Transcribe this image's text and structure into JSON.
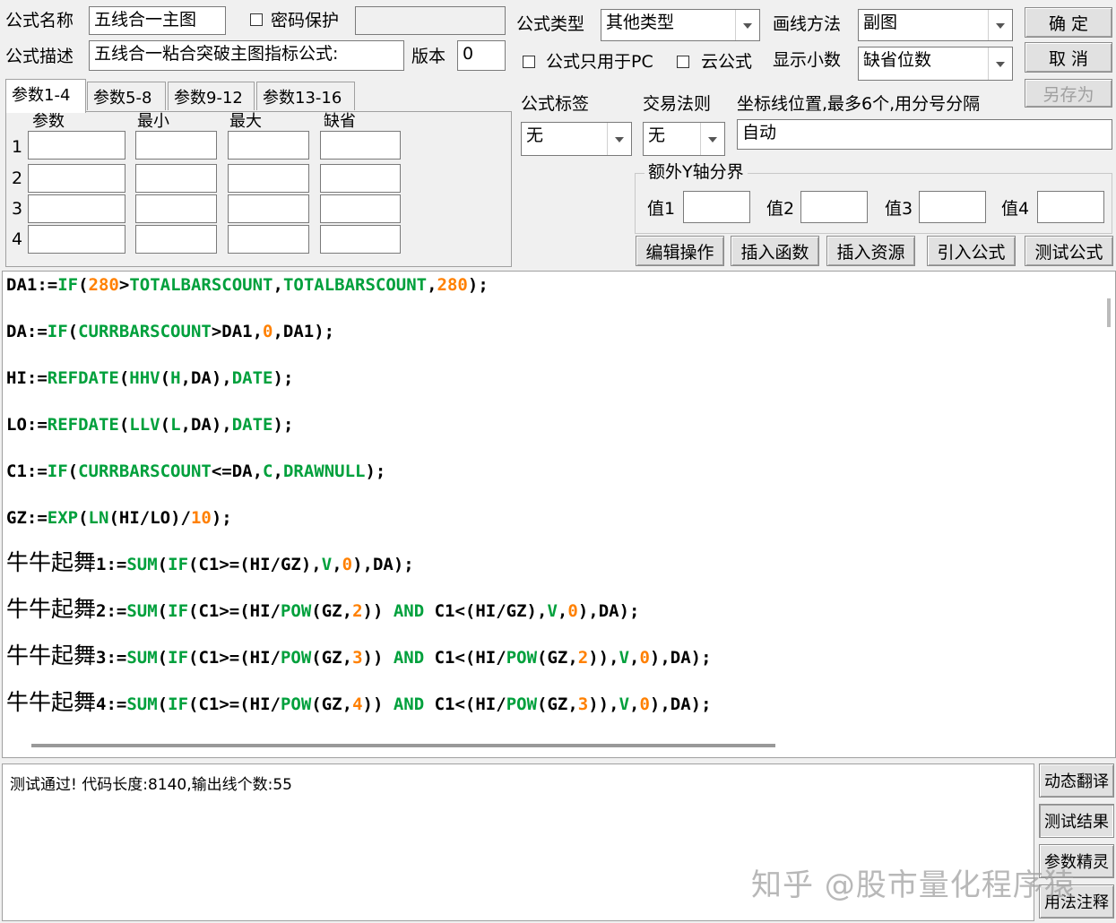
{
  "header": {
    "formula_name_label": "公式名称",
    "formula_name_value": "五线合一主图",
    "password_label": "密码保护",
    "formula_type_label": "公式类型",
    "formula_type_value": "其他类型",
    "draw_method_label": "画线方法",
    "draw_method_value": "副图",
    "formula_desc_label": "公式描述",
    "formula_desc_value": "五线合一粘合突破主图指标公式:",
    "version_label": "版本",
    "version_value": "0",
    "pc_only_label": "公式只用于PC",
    "cloud_label": "云公式",
    "decimals_label": "显示小数",
    "decimals_value": "缺省位数"
  },
  "buttons": {
    "ok": "确 定",
    "cancel": "取 消",
    "save_as": "另存为",
    "edit_ops": "编辑操作",
    "insert_func": "插入函数",
    "insert_res": "插入资源",
    "import_formula": "引入公式",
    "test_formula": "测试公式",
    "dyn_translate": "动态翻译",
    "test_result": "测试结果",
    "param_wizard": "参数精灵",
    "usage_notes": "用法注释"
  },
  "params": {
    "tabs": [
      "参数1-4",
      "参数5-8",
      "参数9-12",
      "参数13-16"
    ],
    "columns": [
      "参数",
      "最小",
      "最大",
      "缺省"
    ],
    "rows": [
      "1",
      "2",
      "3",
      "4"
    ]
  },
  "right_panel": {
    "tag_label": "公式标签",
    "tag_value": "无",
    "trade_rule_label": "交易法则",
    "trade_rule_value": "无",
    "axis_label": "坐标线位置,最多6个,用分号分隔",
    "axis_value": "自动",
    "extra_y_label": "额外Y轴分界",
    "value_labels": [
      "值1",
      "值2",
      "值3",
      "值4"
    ]
  },
  "output": {
    "message": "测试通过! 代码长度:8140,输出线个数:55"
  },
  "watermark": "知乎 @股市量化程序猿",
  "code_lines": [
    [
      [
        "DA1:=",
        ""
      ],
      [
        "IF",
        "kw"
      ],
      [
        "(",
        ""
      ],
      [
        "280",
        "num"
      ],
      [
        ">",
        ""
      ],
      [
        "TOTALBARSCOUNT",
        "kw"
      ],
      [
        ",",
        ""
      ],
      [
        "TOTALBARSCOUNT",
        "kw"
      ],
      [
        ",",
        ""
      ],
      [
        "280",
        "num"
      ],
      [
        ");",
        ""
      ]
    ],
    [
      [
        "DA:=",
        ""
      ],
      [
        "IF",
        "kw"
      ],
      [
        "(",
        ""
      ],
      [
        "CURRBARSCOUNT",
        "kw"
      ],
      [
        ">DA1,",
        ""
      ],
      [
        "0",
        "num"
      ],
      [
        ",DA1);",
        ""
      ]
    ],
    [
      [
        "HI:=",
        ""
      ],
      [
        "REFDATE",
        "kw"
      ],
      [
        "(",
        ""
      ],
      [
        "HHV",
        "kw"
      ],
      [
        "(",
        ""
      ],
      [
        "H",
        "kw"
      ],
      [
        ",DA),",
        ""
      ],
      [
        "DATE",
        "kw"
      ],
      [
        ");",
        ""
      ]
    ],
    [
      [
        "LO:=",
        ""
      ],
      [
        "REFDATE",
        "kw"
      ],
      [
        "(",
        ""
      ],
      [
        "LLV",
        "kw"
      ],
      [
        "(",
        ""
      ],
      [
        "L",
        "kw"
      ],
      [
        ",DA),",
        ""
      ],
      [
        "DATE",
        "kw"
      ],
      [
        ");",
        ""
      ]
    ],
    [
      [
        "C1:=",
        ""
      ],
      [
        "IF",
        "kw"
      ],
      [
        "(",
        ""
      ],
      [
        "CURRBARSCOUNT",
        "kw"
      ],
      [
        "<=DA,",
        ""
      ],
      [
        "C",
        "kw"
      ],
      [
        ",",
        ""
      ],
      [
        "DRAWNULL",
        "kw"
      ],
      [
        ");",
        ""
      ]
    ],
    [
      [
        "GZ:=",
        ""
      ],
      [
        "EXP",
        "kw"
      ],
      [
        "(",
        ""
      ],
      [
        "LN",
        "kw"
      ],
      [
        "(HI/LO)/",
        ""
      ],
      [
        "10",
        "num"
      ],
      [
        ");",
        ""
      ]
    ],
    [
      [
        "牛牛起舞",
        "hz"
      ],
      [
        "1:=",
        ""
      ],
      [
        "SUM",
        "kw"
      ],
      [
        "(",
        ""
      ],
      [
        "IF",
        "kw"
      ],
      [
        "(C1>=(HI/GZ),",
        ""
      ],
      [
        "V",
        "kw"
      ],
      [
        ",",
        ""
      ],
      [
        "0",
        "num"
      ],
      [
        "),DA);",
        ""
      ]
    ],
    [
      [
        "牛牛起舞",
        "hz"
      ],
      [
        "2:=",
        ""
      ],
      [
        "SUM",
        "kw"
      ],
      [
        "(",
        ""
      ],
      [
        "IF",
        "kw"
      ],
      [
        "(C1>=(HI/",
        ""
      ],
      [
        "POW",
        "kw"
      ],
      [
        "(GZ,",
        ""
      ],
      [
        "2",
        "num"
      ],
      [
        ")) ",
        ""
      ],
      [
        "AND",
        "kw"
      ],
      [
        " C1<(HI/GZ),",
        ""
      ],
      [
        "V",
        "kw"
      ],
      [
        ",",
        ""
      ],
      [
        "0",
        "num"
      ],
      [
        "),DA);",
        ""
      ]
    ],
    [
      [
        "牛牛起舞",
        "hz"
      ],
      [
        "3:=",
        ""
      ],
      [
        "SUM",
        "kw"
      ],
      [
        "(",
        ""
      ],
      [
        "IF",
        "kw"
      ],
      [
        "(C1>=(HI/",
        ""
      ],
      [
        "POW",
        "kw"
      ],
      [
        "(GZ,",
        ""
      ],
      [
        "3",
        "num"
      ],
      [
        ")) ",
        ""
      ],
      [
        "AND",
        "kw"
      ],
      [
        " C1<(HI/",
        ""
      ],
      [
        "POW",
        "kw"
      ],
      [
        "(GZ,",
        ""
      ],
      [
        "2",
        "num"
      ],
      [
        ")),",
        ""
      ],
      [
        "V",
        "kw"
      ],
      [
        ",",
        ""
      ],
      [
        "0",
        "num"
      ],
      [
        "),DA);",
        ""
      ]
    ],
    [
      [
        "牛牛起舞",
        "hz"
      ],
      [
        "4:=",
        ""
      ],
      [
        "SUM",
        "kw"
      ],
      [
        "(",
        ""
      ],
      [
        "IF",
        "kw"
      ],
      [
        "(C1>=(HI/",
        ""
      ],
      [
        "POW",
        "kw"
      ],
      [
        "(GZ,",
        ""
      ],
      [
        "4",
        "num"
      ],
      [
        ")) ",
        ""
      ],
      [
        "AND",
        "kw"
      ],
      [
        " C1<(HI/",
        ""
      ],
      [
        "POW",
        "kw"
      ],
      [
        "(GZ,",
        ""
      ],
      [
        "3",
        "num"
      ],
      [
        ")),",
        ""
      ],
      [
        "V",
        "kw"
      ],
      [
        ",",
        ""
      ],
      [
        "0",
        "num"
      ],
      [
        "),DA);",
        ""
      ]
    ]
  ]
}
